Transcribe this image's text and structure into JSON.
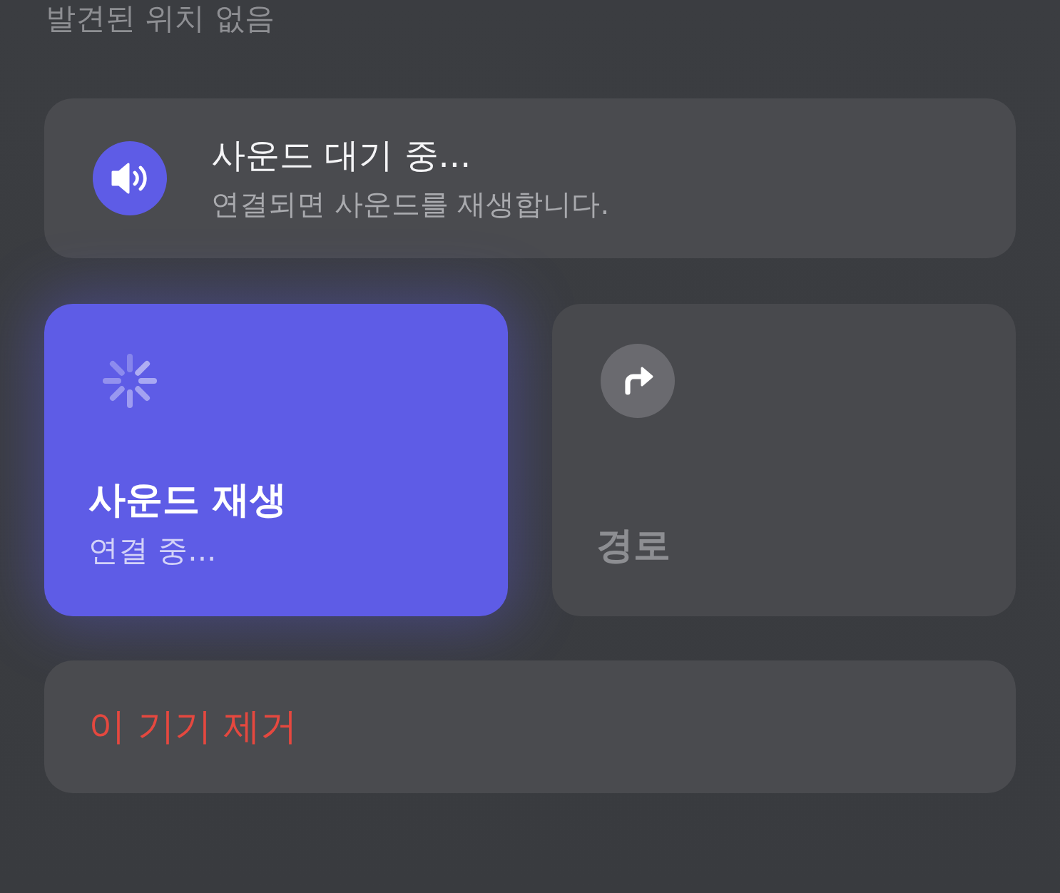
{
  "location_status": "발견된 위치 없음",
  "sound_status": {
    "title": "사운드 대기 중...",
    "subtitle": "연결되면 사운드를 재생합니다."
  },
  "actions": [
    {
      "kind": "sound",
      "label": "사운드 재생",
      "status": "연결 중...",
      "selected": true
    },
    {
      "kind": "directions",
      "label": "경로",
      "selected": false
    }
  ],
  "remove_button": {
    "label": "이 기기 제거"
  }
}
